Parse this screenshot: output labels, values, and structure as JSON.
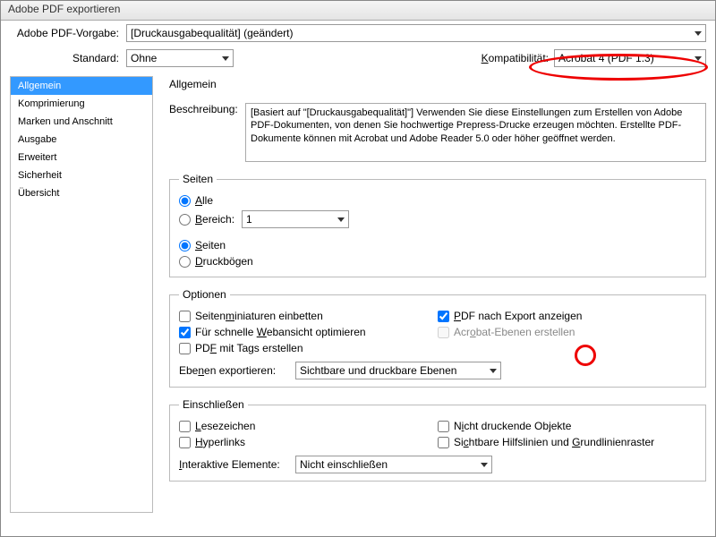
{
  "title": "Adobe PDF exportieren",
  "header": {
    "preset_label": "Adobe PDF-Vorgabe:",
    "preset_value": "[Druckausgabequalität] (geändert)",
    "standard_label": "Standard:",
    "standard_value": "Ohne",
    "compat_label": "Kompatibilität:",
    "compat_value": "Acrobat 4 (PDF 1.3)"
  },
  "sidebar": {
    "items": [
      {
        "label": "Allgemein"
      },
      {
        "label": "Komprimierung"
      },
      {
        "label": "Marken und Anschnitt"
      },
      {
        "label": "Ausgabe"
      },
      {
        "label": "Erweitert"
      },
      {
        "label": "Sicherheit"
      },
      {
        "label": "Übersicht"
      }
    ]
  },
  "main": {
    "heading": "Allgemein",
    "desc_label": "Beschreibung:",
    "desc_text": "[Basiert auf \"[Druckausgabequalität]\"] Verwenden Sie diese Einstellungen zum Erstellen von Adobe PDF-Dokumenten, von denen Sie hochwertige Prepress-Drucke erzeugen möchten. Erstellte PDF-Dokumente können mit Acrobat und Adobe Reader 5.0 oder höher geöffnet werden.",
    "pages": {
      "legend": "Seiten",
      "all": "Alle",
      "range": "Bereich:",
      "range_value": "1",
      "pages_radio": "Seiten",
      "spreads": "Druckbögen"
    },
    "options": {
      "legend": "Optionen",
      "thumbs": "Seitenminiaturen einbetten",
      "view_after": "PDF nach Export anzeigen",
      "fast_web": "Für schnelle Webansicht optimieren",
      "acro_layers": "Acrobat-Ebenen erstellen",
      "tags": "PDF mit Tags erstellen",
      "layers_label": "Ebenen exportieren:",
      "layers_value": "Sichtbare und druckbare Ebenen"
    },
    "include": {
      "legend": "Einschließen",
      "bookmarks": "Lesezeichen",
      "nonprint": "Nicht druckende Objekte",
      "hyperlinks": "Hyperlinks",
      "guides": "Sichtbare Hilfslinien und Grundlinienraster",
      "interactive_label": "Interaktive Elemente:",
      "interactive_value": "Nicht einschließen"
    }
  }
}
